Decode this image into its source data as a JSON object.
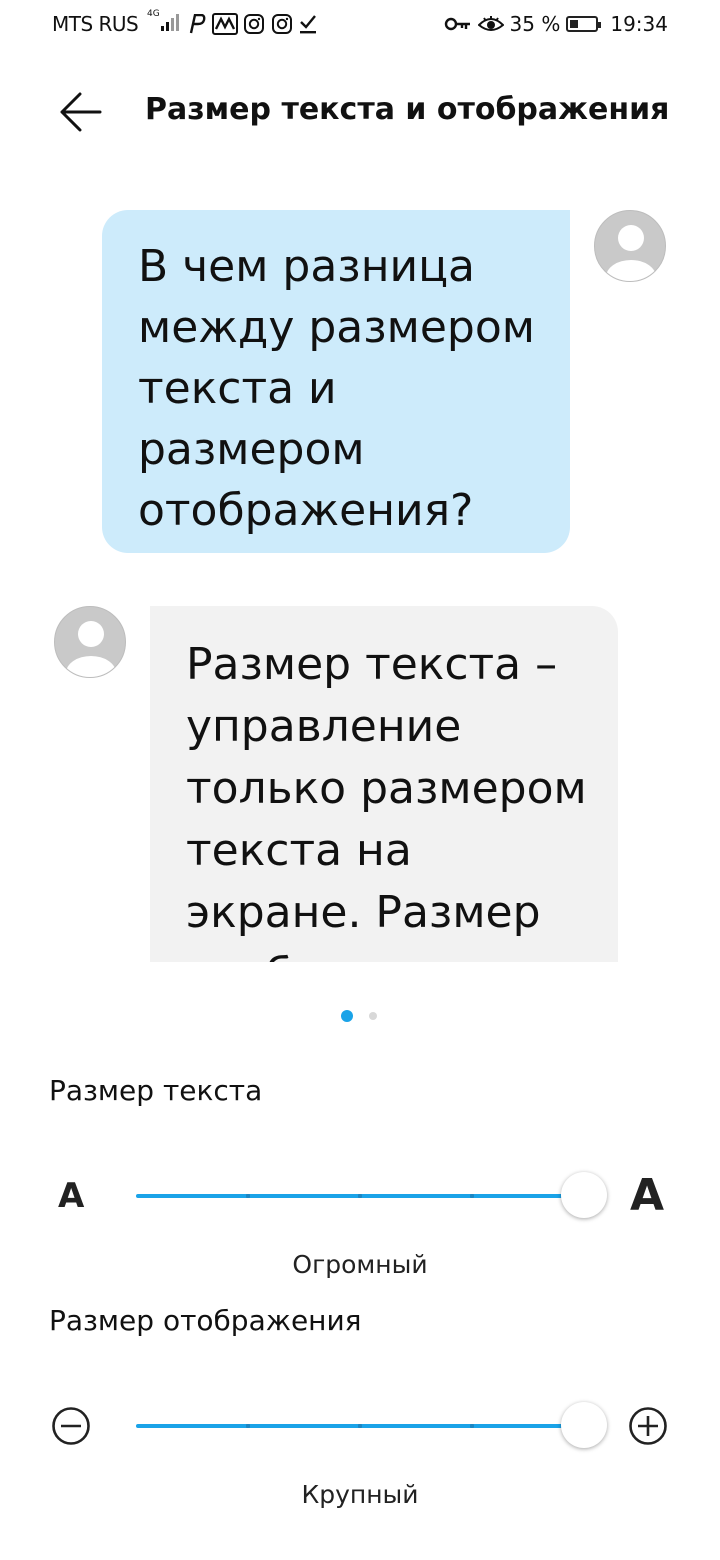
{
  "status_bar": {
    "carrier": "MTS RUS",
    "network": "4G",
    "battery_percent": "35 %",
    "battery_level": 0.35,
    "time": "19:34",
    "icons": [
      "signal-icon",
      "parking-icon",
      "app-icon",
      "instagram-icon",
      "instagram-icon",
      "download-done-icon",
      "key-icon",
      "eye-icon",
      "battery-icon"
    ]
  },
  "header": {
    "title": "Размер текста и отображения",
    "back_icon": "arrow-back-icon"
  },
  "preview": {
    "user_message": "В чем разница между размером текста и размером отображения?",
    "reply_message": "Размер текста – управление только размером текста на экране. Размер отображения"
  },
  "pager": {
    "active_color": "#1aa3e8",
    "inactive_color": "#d8d8d8"
  },
  "text_size": {
    "label": "Размер текста",
    "small_glyph": "A",
    "large_glyph": "A",
    "value": "Огромный",
    "position": 1.0,
    "steps": 5
  },
  "display_size": {
    "label": "Размер отображения",
    "value": "Крупный",
    "position": 1.0,
    "steps": 5
  },
  "colors": {
    "accent": "#1aa3e8",
    "user_bubble": "#cdebfb",
    "reply_bubble": "#f2f2f2"
  }
}
